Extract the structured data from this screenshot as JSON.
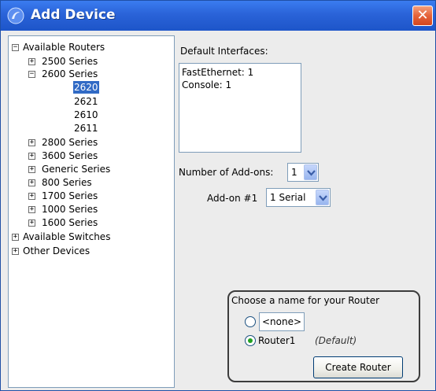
{
  "window": {
    "title": "Add Device",
    "close_label": "✕"
  },
  "tree": {
    "available_routers": {
      "label": "Available Routers",
      "expander": "−",
      "series": [
        {
          "label": "2500 Series",
          "expander": "+"
        },
        {
          "label": "2600 Series",
          "expander": "−",
          "models": [
            "2620",
            "2621",
            "2610",
            "2611"
          ],
          "selected_model": "2620"
        },
        {
          "label": "2800 Series",
          "expander": "+"
        },
        {
          "label": "3600 Series",
          "expander": "+"
        },
        {
          "label": "Generic Series",
          "expander": "+"
        },
        {
          "label": "800 Series",
          "expander": "+"
        },
        {
          "label": "1700 Series",
          "expander": "+"
        },
        {
          "label": "1000 Series",
          "expander": "+"
        },
        {
          "label": "1600 Series",
          "expander": "+"
        }
      ]
    },
    "available_switches": {
      "label": "Available Switches",
      "expander": "+"
    },
    "other_devices": {
      "label": "Other Devices",
      "expander": "+"
    }
  },
  "interfaces": {
    "heading": "Default Interfaces:",
    "items": [
      "FastEthernet: 1",
      "Console: 1"
    ]
  },
  "addons": {
    "count_label": "Number of Add-ons:",
    "count_value": "1",
    "addon1_label": "Add-on #1",
    "addon1_value": "1 Serial"
  },
  "router_name": {
    "heading": "Choose a name for your Router",
    "custom_value": "<none>",
    "default_name": "Router1",
    "default_tag": "(Default)",
    "create_label": "Create Router"
  },
  "colors": {
    "titlebar": "#2a63d8",
    "selection": "#316ac5",
    "close": "#e5633a"
  }
}
